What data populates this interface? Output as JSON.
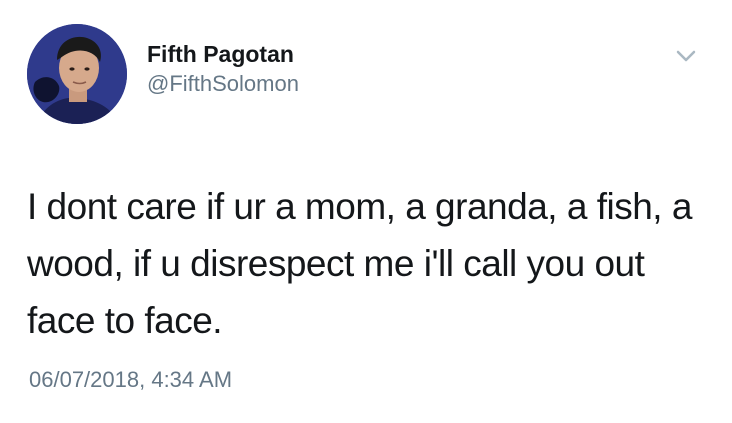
{
  "tweet": {
    "author": {
      "display_name": "Fifth Pagotan",
      "handle": "@FifthSolomon",
      "avatar_icon": "profile-photo"
    },
    "menu_icon": "chevron-down-icon",
    "text": "I dont care if ur a mom, a granda, a fish, a wood, if u disrespect me i'll call you out face to face.",
    "timestamp": "06/07/2018, 4:34 AM"
  },
  "colors": {
    "name": "#14171a",
    "secondary": "#657786",
    "avatar_bg": "#2f3a8c",
    "caret": "#aab8c2"
  }
}
